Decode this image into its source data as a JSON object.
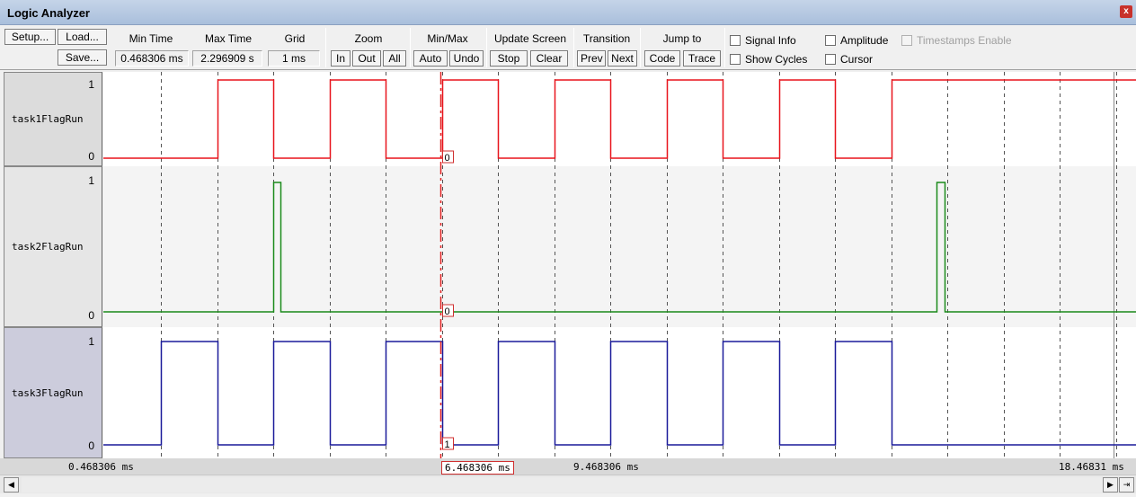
{
  "window": {
    "title": "Logic Analyzer",
    "close_label": "x"
  },
  "toolbar": {
    "setup": "Setup...",
    "load": "Load...",
    "save": "Save...",
    "min_time_label": "Min Time",
    "min_time_value": "0.468306 ms",
    "max_time_label": "Max Time",
    "max_time_value": "2.296909 s",
    "grid_label": "Grid",
    "grid_value": "1 ms",
    "zoom_label": "Zoom",
    "zoom_in": "In",
    "zoom_out": "Out",
    "zoom_all": "All",
    "minmax_label": "Min/Max",
    "minmax_auto": "Auto",
    "minmax_undo": "Undo",
    "update_label": "Update Screen",
    "update_stop": "Stop",
    "update_clear": "Clear",
    "transition_label": "Transition",
    "transition_prev": "Prev",
    "transition_next": "Next",
    "jump_label": "Jump to",
    "jump_code": "Code",
    "jump_trace": "Trace",
    "signal_info": "Signal Info",
    "amplitude": "Amplitude",
    "timestamps_enable": "Timestamps Enable",
    "show_cycles": "Show Cycles",
    "cursor": "Cursor"
  },
  "signals": [
    {
      "name": "task1FlagRun",
      "high_label": "1",
      "low_label": "0",
      "color": "#e8141c",
      "cursor_value": "0"
    },
    {
      "name": "task2FlagRun",
      "high_label": "1",
      "low_label": "0",
      "color": "#1a8a1a",
      "cursor_value": "0"
    },
    {
      "name": "task3FlagRun",
      "high_label": "1",
      "low_label": "0",
      "color": "#1a1a9a",
      "cursor_value": "1"
    }
  ],
  "axis": {
    "left_label": "0.468306 ms",
    "mid_label": "9.468306 ms",
    "right_label": "18.46831 ms",
    "cursor_label": "6.468306 ms"
  },
  "waveforms": {
    "view_start_ms": 0.468306,
    "view_end_ms": 20.468306,
    "cursor_ms": 6.468306,
    "task1_high_intervals_ms": [
      [
        2.5,
        3.5
      ],
      [
        4.5,
        5.5
      ],
      [
        6.5,
        7.5
      ],
      [
        8.5,
        9.5
      ],
      [
        10.5,
        11.5
      ],
      [
        12.5,
        13.5
      ],
      [
        14.5,
        20.5
      ]
    ],
    "task2_high_intervals_ms": [
      [
        3.5,
        3.62
      ],
      [
        15.3,
        15.45
      ]
    ],
    "task3_high_intervals_ms": [
      [
        1.5,
        2.5
      ],
      [
        3.5,
        4.5
      ],
      [
        5.5,
        6.5
      ],
      [
        7.5,
        8.5
      ],
      [
        9.5,
        10.5
      ],
      [
        11.5,
        12.5
      ],
      [
        13.5,
        14.5
      ]
    ]
  }
}
